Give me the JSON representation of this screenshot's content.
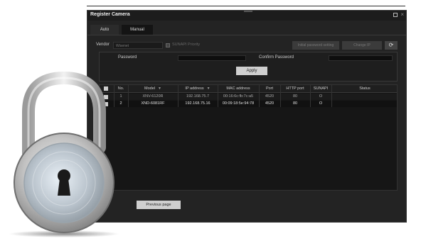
{
  "window": {
    "title": "Register Camera",
    "tabs": [
      {
        "label": "Auto"
      },
      {
        "label": "Manual"
      }
    ]
  },
  "vendor": {
    "label": "Vendor",
    "selected": "Wisenet",
    "sunapi_priority_label": "SUNAPI Priority"
  },
  "toolbar": {
    "initial_password_label": "Initial password setting",
    "change_ip_label": "Change IP",
    "refresh_icon": "refresh-icon"
  },
  "password_panel": {
    "password_label": "Password",
    "confirm_label": "Confirm Password",
    "apply_label": "Apply"
  },
  "table": {
    "columns": [
      "No.",
      "Model",
      "IP address",
      "MAC address",
      "Port",
      "HTTP port",
      "SUNAPI",
      "Status"
    ],
    "rows": [
      {
        "no": "1",
        "model": "XNV-6120R",
        "ip": "192.168.75.7",
        "mac": "00:16:6c:fb:7c:a5",
        "port": "4520",
        "http": "80",
        "sunapi": "O",
        "status": ""
      },
      {
        "no": "2",
        "model": "XND-6081RF",
        "ip": "192.168.75.16",
        "mac": "00:09:18:5e:94:78",
        "port": "4520",
        "http": "80",
        "sunapi": "O",
        "status": ""
      }
    ]
  },
  "footer": {
    "previous_label": "Previous page"
  },
  "colors": {
    "window_bg": "#232323",
    "accent_button": "#cfcfcf",
    "lock_metal": "#c8c8c8"
  }
}
